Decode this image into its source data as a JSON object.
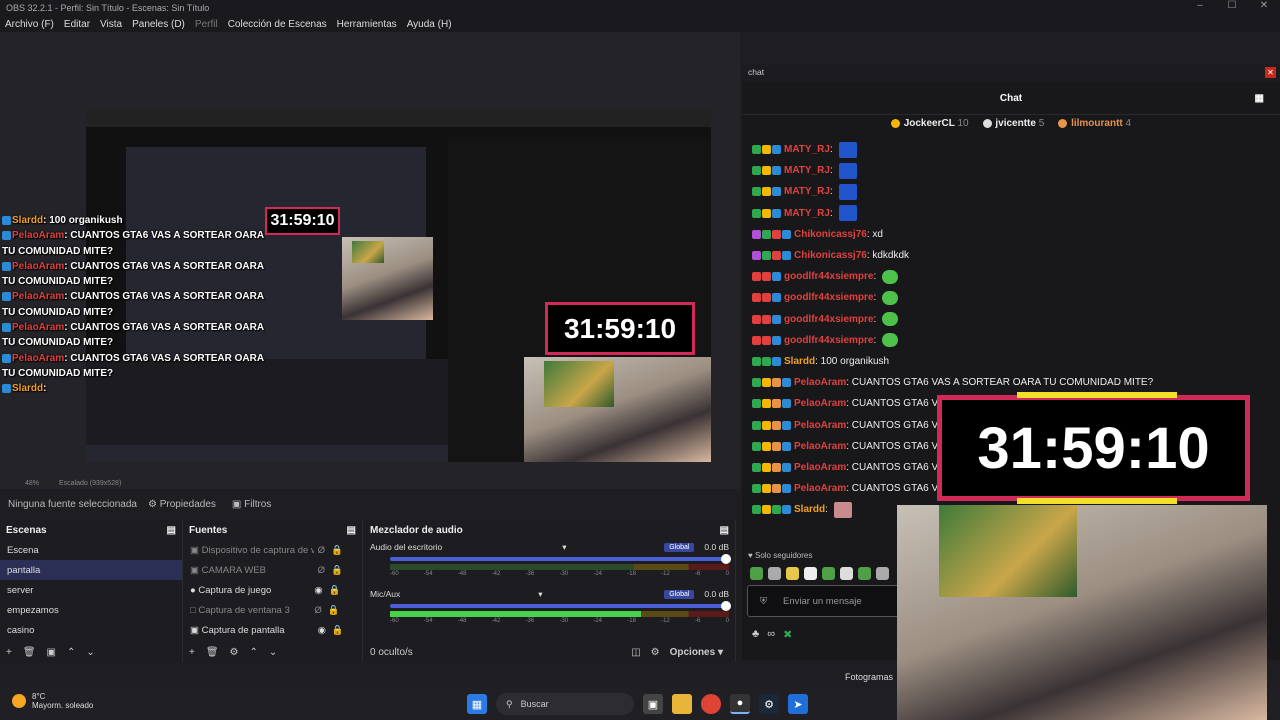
{
  "window": {
    "title": "OBS 32.2.1 - Perfil: Sin Título - Escenas: Sin Título"
  },
  "menu": [
    "Archivo (F)",
    "Editar",
    "Vista",
    "Paneles (D)",
    "Perfil",
    "Colección de Escenas",
    "Herramientas",
    "Ayuda (H)"
  ],
  "preview": {
    "timer": "31:59:10",
    "zoom": "48%",
    "scale_label": "Escalado (939x528)",
    "overlay_chat": [
      {
        "user": "Slardd",
        "text": ": 100 organikush"
      },
      {
        "user": "PelaoAram",
        "text": ": CUANTOS GTA6 VAS A SORTEAR OARA"
      },
      {
        "user": "",
        "text": "TU COMUNIDAD MITE?"
      },
      {
        "user": "PelaoAram",
        "text": ": CUANTOS GTA6 VAS A SORTEAR OARA"
      },
      {
        "user": "",
        "text": "TU COMUNIDAD MITE?"
      },
      {
        "user": "PelaoAram",
        "text": ": CUANTOS GTA6 VAS A SORTEAR OARA"
      },
      {
        "user": "",
        "text": "TU COMUNIDAD MITE?"
      },
      {
        "user": "PelaoAram",
        "text": ": CUANTOS GTA6 VAS A SORTEAR OARA"
      },
      {
        "user": "",
        "text": "TU COMUNIDAD MITE?"
      },
      {
        "user": "PelaoAram",
        "text": ": CUANTOS GTA6 VAS A SORTEAR OARA"
      },
      {
        "user": "",
        "text": "TU COMUNIDAD MITE?"
      },
      {
        "user": "Slardd",
        "text": ":"
      }
    ]
  },
  "source_bar": {
    "no_source": "Ninguna fuente seleccionada",
    "properties": "Propiedades",
    "filters": "Filtros"
  },
  "scenes": {
    "title": "Escenas",
    "items": [
      "Escena",
      "pantalla",
      "server",
      "empezamos",
      "casino"
    ],
    "selected": "pantalla"
  },
  "sources": {
    "title": "Fuentes",
    "items": [
      {
        "label": "Dispositivo de captura de vídeo",
        "visible": false
      },
      {
        "label": "CAMARA WEB",
        "visible": false
      },
      {
        "label": "Captura de juego",
        "visible": true
      },
      {
        "label": "Captura de ventana 3",
        "visible": false
      },
      {
        "label": "Captura de pantalla",
        "visible": true
      }
    ]
  },
  "mixer": {
    "title": "Mezclador de audio",
    "channels": [
      {
        "name": "Audio del escritorio",
        "db": "0.0 dB",
        "tag": "Global",
        "level": 0
      },
      {
        "name": "Mic/Aux",
        "db": "0.0 dB",
        "tag": "Global",
        "level": 0.74
      }
    ],
    "ticks": [
      "-60",
      "-54",
      "-48",
      "-42",
      "-36",
      "-30",
      "-24",
      "-18",
      "-12",
      "-6",
      "0"
    ],
    "hidden": "0 oculto/s",
    "options": "Opciones"
  },
  "chat": {
    "window_title": "chat",
    "header": "Chat",
    "leaders": [
      {
        "name": "JockeerCL",
        "count": "10",
        "color": "#f5b700"
      },
      {
        "name": "jvicentte",
        "count": "5",
        "color": "#ffffff"
      },
      {
        "name": "lilmourantt",
        "count": "4",
        "color": "#e8934a"
      }
    ],
    "messages": [
      {
        "user": "MATY_RJ",
        "color": "#e0413f",
        "text": ":"
      },
      {
        "user": "MATY_RJ",
        "color": "#e0413f",
        "text": ":"
      },
      {
        "user": "MATY_RJ",
        "color": "#e0413f",
        "text": ":"
      },
      {
        "user": "MATY_RJ",
        "color": "#e0413f",
        "text": ":"
      },
      {
        "user": "Chikonicassj76",
        "color": "#e0413f",
        "text": ": xd"
      },
      {
        "user": "Chikonicassj76",
        "color": "#e0413f",
        "text": ": kdkdkdk"
      },
      {
        "user": "goodlfr44xsiempre",
        "color": "#e0413f",
        "text": ":"
      },
      {
        "user": "goodlfr44xsiempre",
        "color": "#e0413f",
        "text": ":"
      },
      {
        "user": "goodlfr44xsiempre",
        "color": "#e0413f",
        "text": ":"
      },
      {
        "user": "goodlfr44xsiempre",
        "color": "#e0413f",
        "text": ":"
      },
      {
        "user": "Slardd",
        "color": "#f4a020",
        "text": ": 100 organikush"
      },
      {
        "user": "PelaoAram",
        "color": "#e0413f",
        "text": ": CUANTOS GTA6 VAS A SORTEAR OARA TU COMUNIDAD MITE?"
      },
      {
        "user": "PelaoAram",
        "color": "#e0413f",
        "text": ": CUANTOS GTA6 VAS A SORTEAR OARA TU COMUNIDAD MITE?"
      },
      {
        "user": "PelaoAram",
        "color": "#e0413f",
        "text": ": CUANTOS GTA6 VAS A SORTEAR OARA TU COMUNIDAD MITE?"
      },
      {
        "user": "PelaoAram",
        "color": "#e0413f",
        "text": ": CUANTOS GTA6 VAS A SORTEAR OARA TU COMUNIDAD MITE?"
      },
      {
        "user": "PelaoAram",
        "color": "#e0413f",
        "text": ": CUANTOS GTA6 VAS A SORTEAR OARA TU COMUNIDAD MITE?"
      },
      {
        "user": "PelaoAram",
        "color": "#e0413f",
        "text": ": CUANTOS GTA6 VAS A SORTEAR OARA TU COMUNIDAD MITE?"
      },
      {
        "user": "Slardd",
        "color": "#f4a020",
        "text": ":"
      }
    ],
    "followers_only": "Solo seguidores",
    "input_placeholder": "Enviar un mensaje"
  },
  "status": {
    "frames": "Fotogramas"
  },
  "taskbar": {
    "temp": "8°C",
    "condition": "Mayorm. soleado",
    "search": "Buscar"
  }
}
